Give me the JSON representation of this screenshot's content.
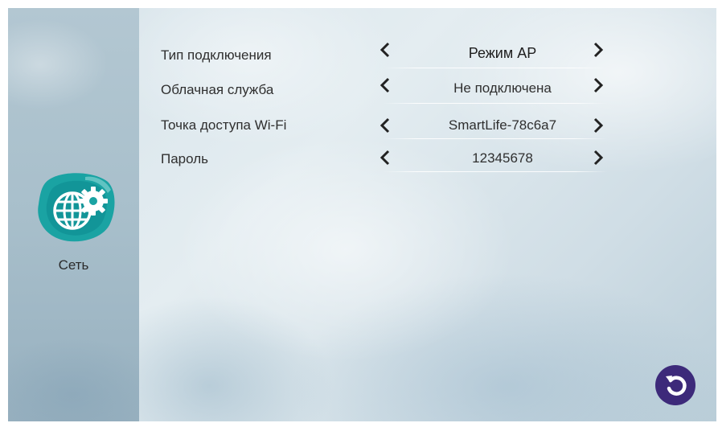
{
  "sidebar": {
    "category_label": "Сеть",
    "category_icon": "network-settings-icon",
    "icon_colors": {
      "teal": "#1aa3a3",
      "dark_teal": "#0d7f86"
    }
  },
  "settings": [
    {
      "label": "Тип подключения",
      "value": "Режим AP"
    },
    {
      "label": "Облачная служба",
      "value": "Не подключена"
    },
    {
      "label": "Точка доступа Wi-Fi",
      "value": "SmartLife-78c6a7"
    },
    {
      "label": "Пароль",
      "value": "12345678"
    }
  ],
  "controls": {
    "prev_icon": "chevron-left-icon",
    "next_icon": "chevron-right-icon",
    "back_icon": "back-arrow-icon",
    "back_color": "#3d2a7a"
  }
}
